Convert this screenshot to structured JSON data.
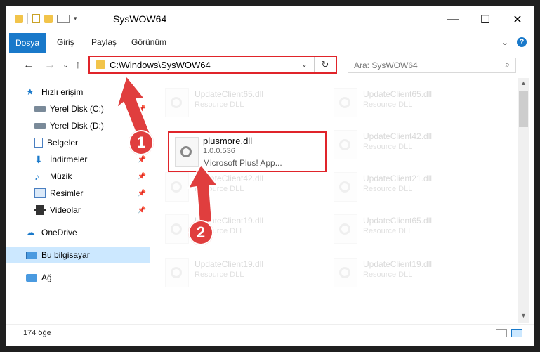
{
  "window": {
    "title": "SysWOW64",
    "controls": {
      "minimize": "—",
      "maximize": "☐",
      "close": "✕"
    }
  },
  "ribbon": {
    "tabs": [
      "Dosya",
      "Giriş",
      "Paylaş",
      "Görünüm"
    ],
    "collapse_icon": "chevron-down-icon",
    "help_label": "?"
  },
  "nav": {
    "back": "←",
    "forward": "→",
    "recent": "⌄",
    "up": "↑",
    "address_path": "C:\\Windows\\SysWOW64",
    "address_drop": "⌄",
    "refresh": "↻",
    "search_placeholder": "Ara: SysWOW64",
    "search_icon": "⌕"
  },
  "sidebar": {
    "items": [
      {
        "label": "Hızlı erişim",
        "icon": "star-icon",
        "pinned": false
      },
      {
        "label": "Yerel Disk (C:)",
        "icon": "drive-icon",
        "pinned": true
      },
      {
        "label": "Yerel Disk (D:)",
        "icon": "drive-icon",
        "pinned": true
      },
      {
        "label": "Belgeler",
        "icon": "documents-icon",
        "pinned": true
      },
      {
        "label": "İndirmeler",
        "icon": "download-icon",
        "pinned": true
      },
      {
        "label": "Müzik",
        "icon": "music-icon",
        "pinned": true
      },
      {
        "label": "Resimler",
        "icon": "pictures-icon",
        "pinned": true
      },
      {
        "label": "Videolar",
        "icon": "videos-icon",
        "pinned": true
      },
      {
        "label": "OneDrive",
        "icon": "cloud-icon",
        "pinned": false
      },
      {
        "label": "Bu bilgisayar",
        "icon": "computer-icon",
        "pinned": false,
        "selected": true
      },
      {
        "label": "Ağ",
        "icon": "network-icon",
        "pinned": false
      }
    ]
  },
  "files": {
    "left_column": [
      {
        "name": "UpdateClient65.dll",
        "type": "Resource DLL"
      },
      {
        "name": "UpdateClient42.dll",
        "type": "Resource DLL"
      },
      {
        "name": "UpdateClient19.dll",
        "type": "Resource DLL"
      },
      {
        "name": "UpdateClient19.dll",
        "type": "Resource DLL"
      }
    ],
    "right_column": [
      {
        "name": "UpdateClient65.dll",
        "type": "Resource DLL"
      },
      {
        "name": "UpdateClient42.dll",
        "type": "Resource DLL"
      },
      {
        "name": "UpdateClient21.dll",
        "type": "Resource DLL"
      },
      {
        "name": "UpdateClient65.dll",
        "type": "Resource DLL"
      },
      {
        "name": "UpdateClient19.dll",
        "type": "Resource DLL"
      }
    ],
    "featured": {
      "name": "plusmore.dll",
      "version": "1.0.0.536",
      "description": "Microsoft Plus! App..."
    }
  },
  "annotations": {
    "badge1": "1",
    "badge2": "2",
    "highlight_color": "#e0242a",
    "badge_color": "#e03e3e"
  },
  "status": {
    "item_count": "174 öğe"
  }
}
